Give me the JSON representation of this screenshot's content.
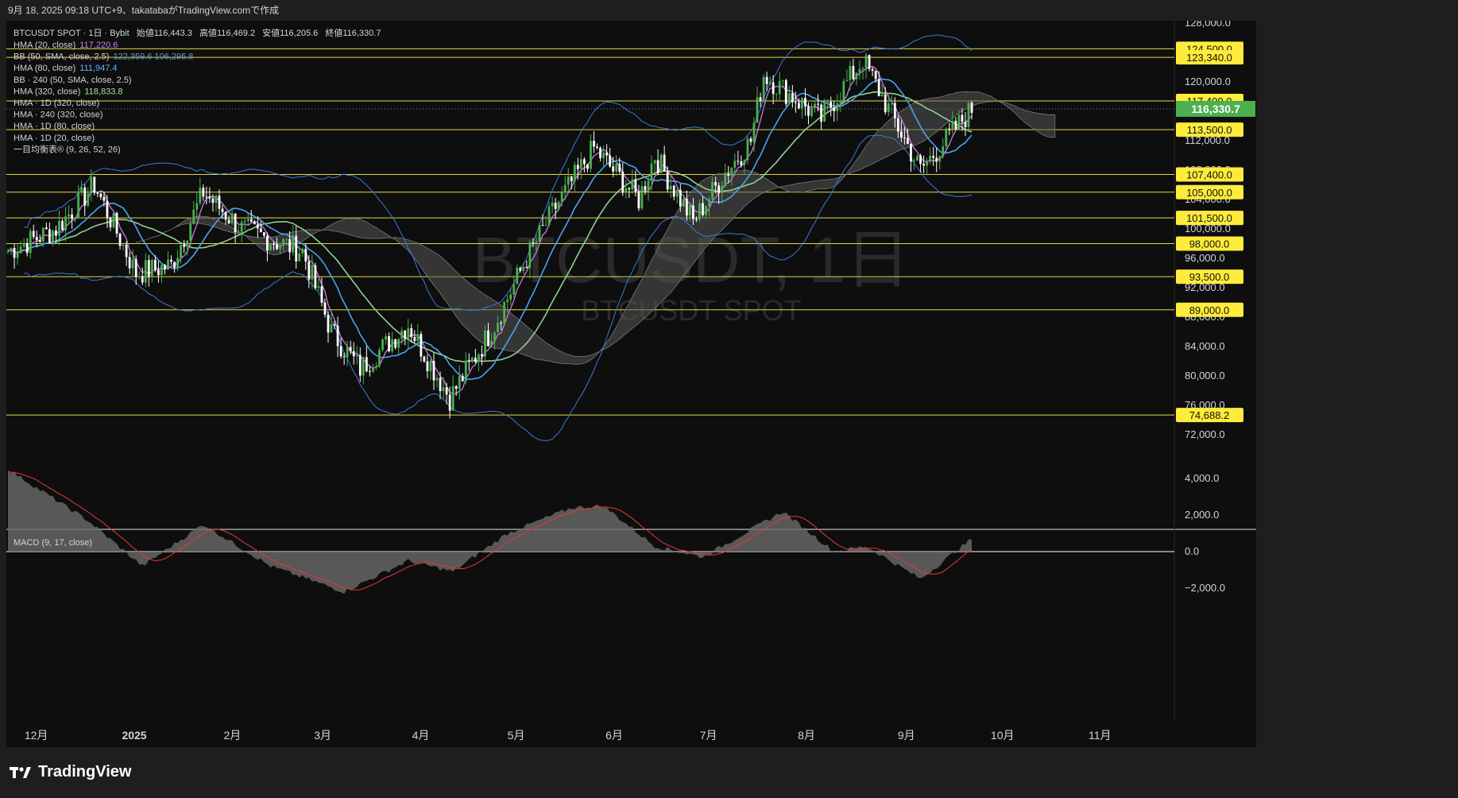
{
  "header": {
    "caption": "9月 18, 2025 09:18 UTC+9、takatabaがTradingView.comで作成"
  },
  "legend": {
    "symbol_line": "BTCUSDT SPOT · 1日 · Bybit",
    "open_label": "始値",
    "open": "116,443.3",
    "high_label": "高値",
    "high": "116,469.2",
    "low_label": "安値",
    "low": "116,205.6",
    "close_label": "終値",
    "close": "116,330.7",
    "indicators": [
      {
        "label": "HMA (20, close)",
        "value": "117,220.6",
        "color": "#d085e8"
      },
      {
        "label": "BB (50, SMA, close, 2.5)",
        "value": "122,359.6  106,295.8",
        "color": "#5b9bd5"
      },
      {
        "label": "HMA (80, close)",
        "value": "111,947.4",
        "color": "#6ab0ff"
      },
      {
        "label": "BB · 240 (50, SMA, close, 2.5)",
        "value": "",
        "color": "#d1d4dc"
      },
      {
        "label": "HMA (320, close)",
        "value": "118,833.8",
        "color": "#a6e3a1"
      },
      {
        "label": "HMA · 1D (320, close)",
        "value": "",
        "color": "#d1d4dc"
      },
      {
        "label": "HMA · 240 (320, close)",
        "value": "",
        "color": "#d1d4dc"
      },
      {
        "label": "HMA · 1D (80, close)",
        "value": "",
        "color": "#d1d4dc"
      },
      {
        "label": "HMA · 1D (20, close)",
        "value": "",
        "color": "#d1d4dc"
      },
      {
        "label": "一目均衡表® (9, 26, 52, 26)",
        "value": "",
        "color": "#d1d4dc"
      }
    ]
  },
  "watermark": {
    "main": "BTCUSDT, 1日",
    "sub": "BTCUSDT SPOT"
  },
  "price_axis": {
    "ticks": [
      "128,000.0",
      "124,000.0",
      "120,000.0",
      "116,000.0",
      "112,000.0",
      "108,000.0",
      "104,000.0",
      "100,000.0",
      "96,000.0",
      "92,000.0",
      "88,000.0",
      "84,000.0",
      "80,000.0",
      "76,000.0",
      "72,000.0"
    ]
  },
  "levels": [
    "124,500.0",
    "123,340.0",
    "117,400.0",
    "113,500.0",
    "107,400.0",
    "105,000.0",
    "101,500.0",
    "98,000.0",
    "93,500.0",
    "89,000.0",
    "74,688.2"
  ],
  "current_price": "116,330.7",
  "macd": {
    "label": "MACD (9, 17, close)",
    "ticks": [
      "4,000.0",
      "2,000.0",
      "0.0",
      "−2,000.0"
    ]
  },
  "time_axis": [
    "12月",
    "2025",
    "2月",
    "3月",
    "4月",
    "5月",
    "6月",
    "7月",
    "8月",
    "9月",
    "10月",
    "11月"
  ],
  "footer": {
    "brand": "TradingView"
  },
  "colors": {
    "up": "#4caf50",
    "down": "#ffffff",
    "level": "#e6d84a",
    "level_label_bg": "#ffeb3b",
    "current_bg": "#4caf50",
    "hma20": "#c77dde",
    "hma80": "#4aa3f0",
    "hma320": "#8fd18f",
    "bb": "#3a7bd5",
    "cloud": "#555555",
    "macd_line": "#e53935"
  },
  "chart_data": {
    "type": "candlestick",
    "symbol": "BTCUSDT SPOT",
    "timeframe": "1日",
    "exchange": "Bybit",
    "ohlc_last": {
      "open": 116443.3,
      "high": 116469.2,
      "low": 116205.6,
      "close": 116330.7
    },
    "ylim": [
      70000,
      128000
    ],
    "x_range": [
      "2024-11-20",
      "2025-11-05"
    ],
    "horizontal_levels": [
      124500,
      123340,
      117400,
      113500,
      107400,
      105000,
      101500,
      98000,
      93500,
      89000,
      74688.2
    ],
    "hma20_last": 117220.6,
    "bb_upper_last": 122359.6,
    "bb_lower_last": 106295.8,
    "hma80_last": 111947.4,
    "hma320_last": 118833.8,
    "close_path": [
      {
        "x": "2024-11-20",
        "y": 97000
      },
      {
        "x": "2024-12-05",
        "y": 100000
      },
      {
        "x": "2024-12-17",
        "y": 106000
      },
      {
        "x": "2024-12-30",
        "y": 94000
      },
      {
        "x": "2025-01-10",
        "y": 95000
      },
      {
        "x": "2025-01-20",
        "y": 105000
      },
      {
        "x": "2025-02-01",
        "y": 100000
      },
      {
        "x": "2025-02-20",
        "y": 97000
      },
      {
        "x": "2025-03-01",
        "y": 86000
      },
      {
        "x": "2025-03-10",
        "y": 81000
      },
      {
        "x": "2025-03-25",
        "y": 87000
      },
      {
        "x": "2025-04-07",
        "y": 77000
      },
      {
        "x": "2025-04-21",
        "y": 87000
      },
      {
        "x": "2025-05-01",
        "y": 96000
      },
      {
        "x": "2025-05-10",
        "y": 103000
      },
      {
        "x": "2025-05-22",
        "y": 111000
      },
      {
        "x": "2025-06-05",
        "y": 104000
      },
      {
        "x": "2025-06-10",
        "y": 110000
      },
      {
        "x": "2025-06-22",
        "y": 101000
      },
      {
        "x": "2025-07-01",
        "y": 107000
      },
      {
        "x": "2025-07-10",
        "y": 112000
      },
      {
        "x": "2025-07-14",
        "y": 121000
      },
      {
        "x": "2025-08-01",
        "y": 115000
      },
      {
        "x": "2025-08-14",
        "y": 123000
      },
      {
        "x": "2025-09-01",
        "y": 108000
      },
      {
        "x": "2025-09-17",
        "y": 116330.7
      }
    ],
    "macd_line": [
      {
        "x": "2024-11-20",
        "y": 4500
      },
      {
        "x": "2024-12-15",
        "y": 1700
      },
      {
        "x": "2025-01-01",
        "y": -800
      },
      {
        "x": "2025-01-20",
        "y": 1500
      },
      {
        "x": "2025-02-10",
        "y": -800
      },
      {
        "x": "2025-03-05",
        "y": -2200
      },
      {
        "x": "2025-03-25",
        "y": -500
      },
      {
        "x": "2025-04-08",
        "y": -1100
      },
      {
        "x": "2025-04-25",
        "y": 1000
      },
      {
        "x": "2025-05-15",
        "y": 2400
      },
      {
        "x": "2025-05-25",
        "y": 2500
      },
      {
        "x": "2025-06-10",
        "y": 300
      },
      {
        "x": "2025-06-25",
        "y": -300
      },
      {
        "x": "2025-07-20",
        "y": 2200
      },
      {
        "x": "2025-08-05",
        "y": 0
      },
      {
        "x": "2025-08-15",
        "y": 300
      },
      {
        "x": "2025-09-01",
        "y": -1500
      },
      {
        "x": "2025-09-17",
        "y": 700
      }
    ]
  }
}
